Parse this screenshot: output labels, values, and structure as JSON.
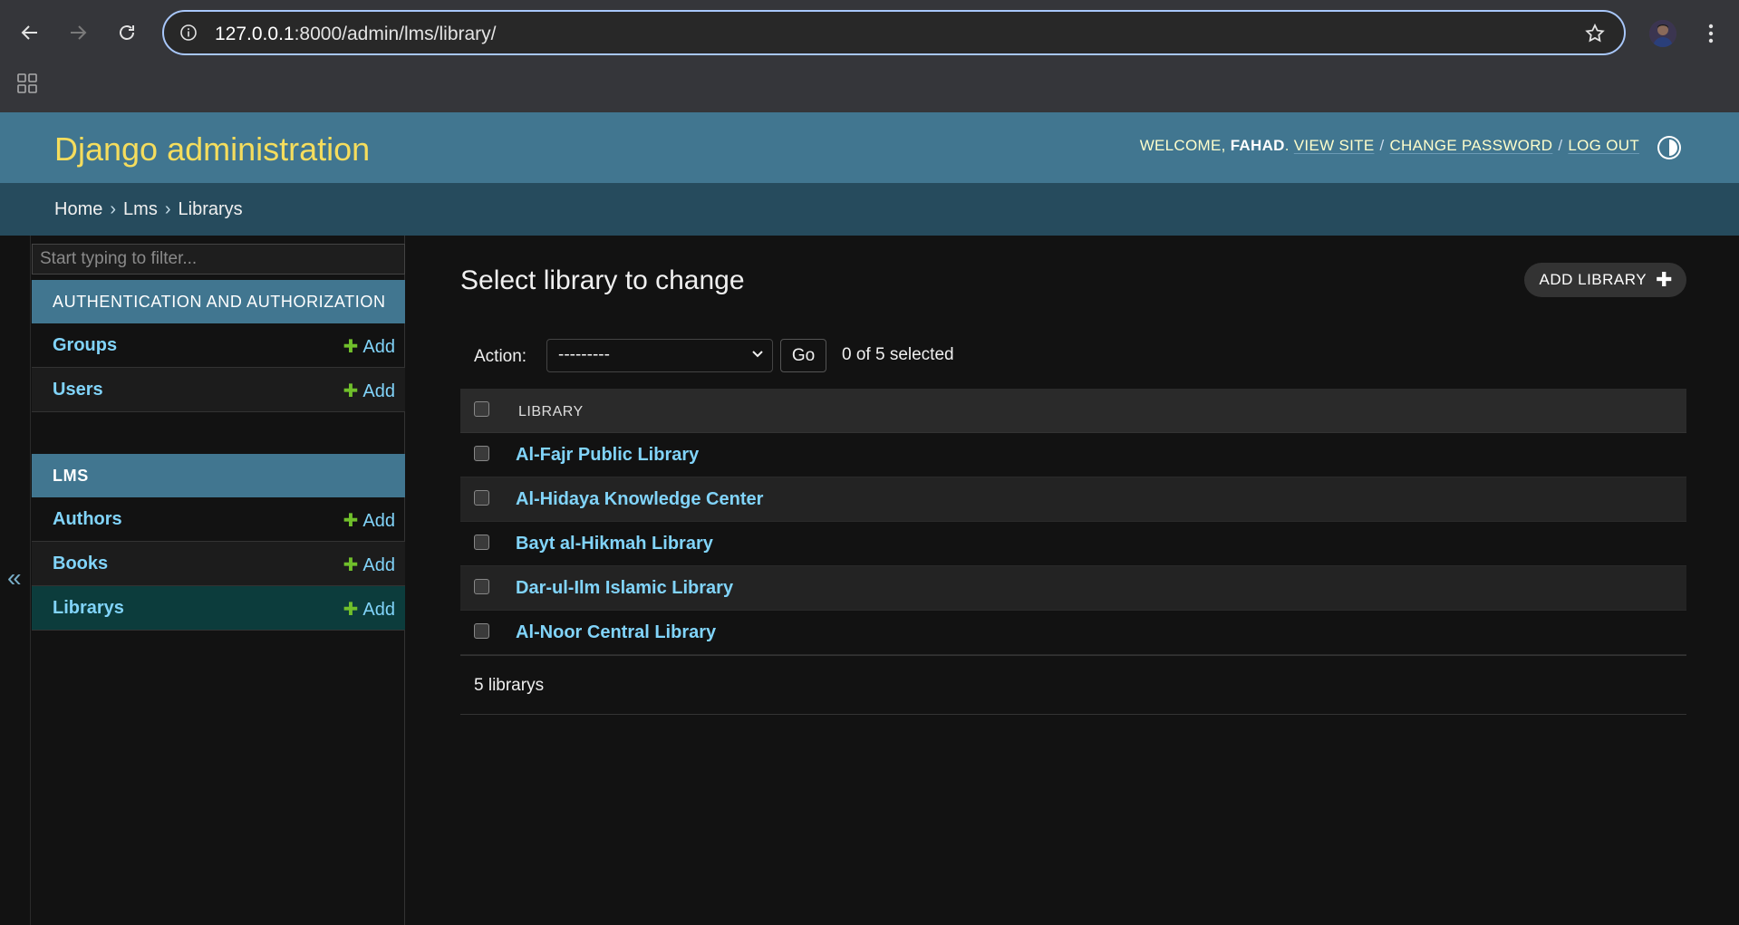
{
  "browser": {
    "url_host": "127.0.0.1",
    "url_rest": ":8000/admin/lms/library/"
  },
  "header": {
    "branding": "Django administration",
    "welcome": "WELCOME,",
    "username": "FAHAD",
    "view_site": "VIEW SITE",
    "change_password": "CHANGE PASSWORD",
    "log_out": "LOG OUT"
  },
  "breadcrumbs": {
    "home": "Home",
    "app": "Lms",
    "model": "Librarys"
  },
  "sidebar": {
    "filter_placeholder": "Start typing to filter...",
    "collapse": "«",
    "modules": [
      {
        "caption": "AUTHENTICATION AND AUTHORIZATION",
        "models": [
          {
            "name": "Groups",
            "add": "Add"
          },
          {
            "name": "Users",
            "add": "Add"
          }
        ]
      },
      {
        "caption": "LMS",
        "models": [
          {
            "name": "Authors",
            "add": "Add"
          },
          {
            "name": "Books",
            "add": "Add"
          },
          {
            "name": "Librarys",
            "add": "Add"
          }
        ]
      }
    ]
  },
  "main": {
    "title": "Select library to change",
    "add_button": "ADD LIBRARY",
    "action_label": "Action:",
    "action_value": "---------",
    "go": "Go",
    "selected": "0 of 5 selected",
    "column_header": "LIBRARY",
    "rows": [
      "Al-Fajr Public Library",
      "Al-Hidaya Knowledge Center",
      "Bayt al-Hikmah Library",
      "Dar-ul-Ilm Islamic Library",
      "Al-Noor Central Library"
    ],
    "count": "5 librarys"
  },
  "colors": {
    "header_bg": "#417690",
    "breadcrumb_bg": "#264b5d",
    "branding": "#f5dd5d",
    "link": "#81d4fa",
    "add_plus": "#70bf2b"
  }
}
